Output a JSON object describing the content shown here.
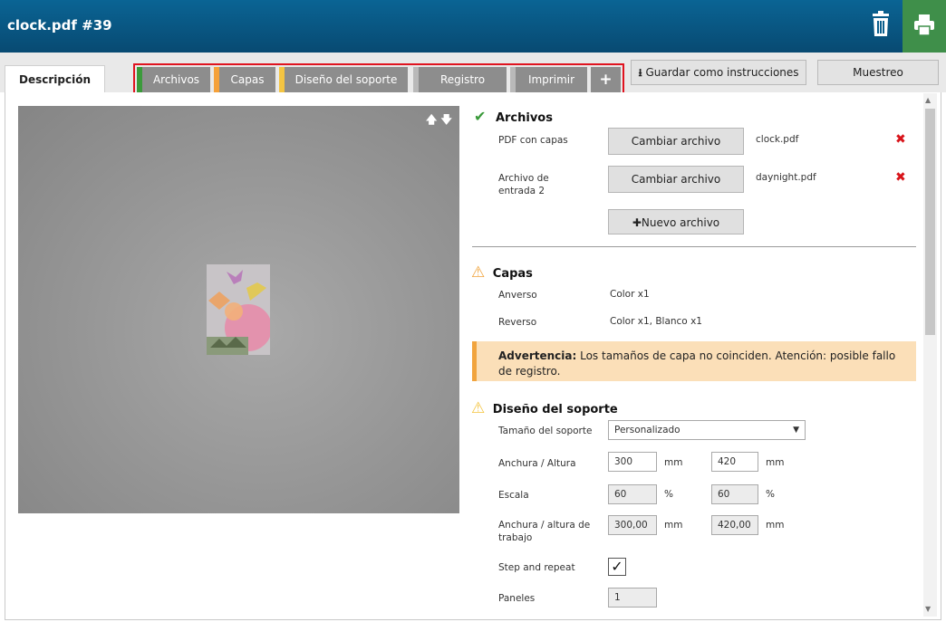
{
  "window": {
    "title": "clock.pdf #39"
  },
  "header_icons": {
    "delete": "trash-icon",
    "print": "printer-icon"
  },
  "tabs": {
    "description": "Descripción",
    "steps": [
      {
        "label": "Archivos",
        "color": "#3a9a3a"
      },
      {
        "label": "Capas",
        "color": "#f5a13a"
      },
      {
        "label": "Diseño del soporte",
        "color": "#f4c542"
      },
      {
        "label": "Registro",
        "color": "#b9b9b9"
      },
      {
        "label": "Imprimir",
        "color": "#b9b9b9"
      }
    ],
    "add": "+"
  },
  "toolbar": {
    "save_instructions": "Guardar como instrucciones",
    "sampling": "Muestreo"
  },
  "preview": {
    "arrows": "🡅 🡇"
  },
  "files": {
    "title": "Archivos",
    "rows": [
      {
        "label": "PDF con capas",
        "button": "Cambiar archivo",
        "file": "clock.pdf"
      },
      {
        "label": "Archivo de entrada 2",
        "button": "Cambiar archivo",
        "file": "daynight.pdf"
      }
    ],
    "new_button": "Nuevo archivo"
  },
  "layers": {
    "title": "Capas",
    "front_label": "Anverso",
    "front_value": "Color x1",
    "back_label": "Reverso",
    "back_value": "Color x1, Blanco x1",
    "warning_bold": "Advertencia:",
    "warning_text": " Los tamaños de capa no coinciden. Atención: posible fallo de registro."
  },
  "media": {
    "title": "Diseño del soporte",
    "size_label": "Tamaño del soporte",
    "size_value": "Personalizado",
    "wh_label": "Anchura / Altura",
    "width": "300",
    "height": "420",
    "scale_label": "Escala",
    "scale_x": "60",
    "scale_y": "60",
    "work_label": "Anchura / altura de trabajo",
    "work_w": "300,00",
    "work_h": "420,00",
    "step_label": "Step and repeat",
    "step_checked": "✓",
    "panels_label": "Paneles",
    "panels": "1",
    "unit_mm": "mm",
    "unit_pct": "%"
  },
  "colors": {
    "titlebar": "#0a5e8c",
    "print": "#3f8f4a",
    "warning_bg": "#fbdfb8",
    "error": "#d8141a",
    "ok": "#3a9a3a"
  }
}
